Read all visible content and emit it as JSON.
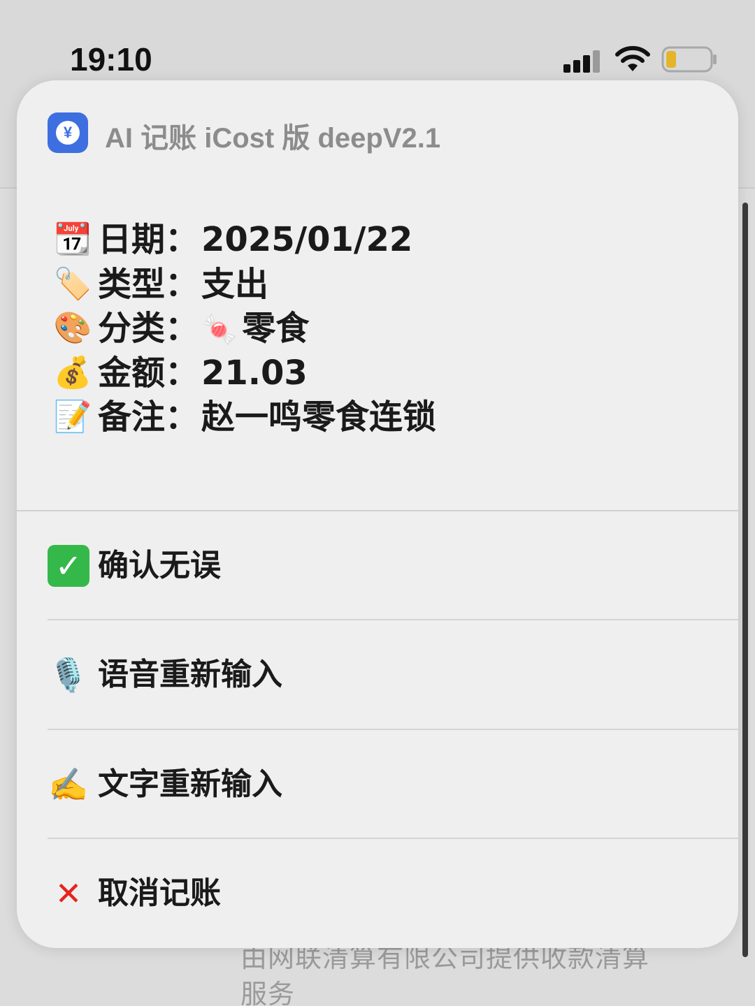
{
  "status_bar": {
    "time": "19:10"
  },
  "sheet": {
    "app_title": "AI 记账 iCost 版 deepV2.1",
    "app_icon_glyph": "¥",
    "record": [
      {
        "icon": "calendar-icon",
        "emoji": "📆",
        "label": "日期：",
        "value": "2025/01/22",
        "value_emoji": ""
      },
      {
        "icon": "tag-icon",
        "emoji": "🏷️",
        "label": "类型：",
        "value": "支出",
        "value_emoji": ""
      },
      {
        "icon": "palette-icon",
        "emoji": "🎨",
        "label": "分类：",
        "value": "零食",
        "value_emoji": "🍬"
      },
      {
        "icon": "money-bag-icon",
        "emoji": "💰",
        "label": "金额：",
        "value": "21.03",
        "value_emoji": ""
      },
      {
        "icon": "memo-icon",
        "emoji": "📝",
        "label": "备注：",
        "value": "赵一鸣零食连锁",
        "value_emoji": ""
      }
    ],
    "actions": [
      {
        "icon": "check-icon",
        "glyph": "✓",
        "label": "确认无误"
      },
      {
        "icon": "microphone-icon",
        "glyph": "🎙️",
        "label": "语音重新输入"
      },
      {
        "icon": "writing-hand-icon",
        "glyph": "✍️",
        "label": "文字重新输入"
      },
      {
        "icon": "cross-icon",
        "glyph": "✕",
        "label": "取消记账"
      }
    ]
  },
  "background": {
    "footer_text_line1": "由网联清算有限公司提供收款清算",
    "footer_text_line2": "服务"
  },
  "colors": {
    "app_icon": "#3d6fe0",
    "check": "#35b84a",
    "cross": "#e3261c"
  }
}
